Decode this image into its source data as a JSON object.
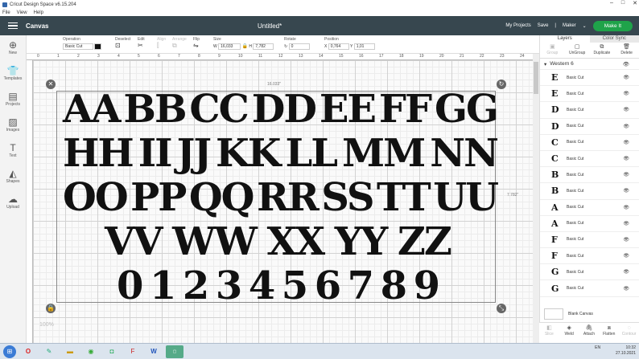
{
  "window": {
    "title": "Cricut Design Space  v6.15.204"
  },
  "menu": [
    "File",
    "View",
    "Help"
  ],
  "header": {
    "section": "Canvas",
    "doc_title": "Untitled*",
    "my_projects": "My Projects",
    "save": "Save",
    "machine": "Maker",
    "make_it": "Make It"
  },
  "sidebar": [
    {
      "label": "New",
      "icon": "plus-icon"
    },
    {
      "label": "Templates",
      "icon": "shirt-icon"
    },
    {
      "label": "Projects",
      "icon": "folder-icon"
    },
    {
      "label": "Images",
      "icon": "image-icon"
    },
    {
      "label": "Text",
      "icon": "text-icon"
    },
    {
      "label": "Shapes",
      "icon": "shapes-icon"
    },
    {
      "label": "Upload",
      "icon": "cloud-upload-icon"
    }
  ],
  "toolbar": {
    "operation_label": "Operation",
    "operation_value": "Basic Cut",
    "deselect": "Deselect",
    "edit": "Edit",
    "align": "Align",
    "arrange": "Arrange",
    "flip": "Flip",
    "size_label": "Size",
    "w_label": "W",
    "w_value": "16,033",
    "h_label": "H",
    "h_value": "7,782",
    "rotate_label": "Rotate",
    "rotate_value": "0",
    "position_label": "Position",
    "x_label": "X",
    "x_value": "0,764",
    "y_label": "Y",
    "y_value": "1,01",
    "swatch_color": "#111111"
  },
  "ruler_top": [
    "0",
    "1",
    "2",
    "3",
    "4",
    "5",
    "6",
    "7",
    "8",
    "9",
    "10",
    "11",
    "12",
    "13",
    "14",
    "15",
    "16",
    "17",
    "18",
    "19",
    "20",
    "21",
    "22",
    "23",
    "24"
  ],
  "canvas": {
    "width_label": "16.033\"",
    "height_label": "7.782\"",
    "zoom": "100%",
    "rows": [
      [
        "AA",
        "BB",
        "CC",
        "DD",
        "EE",
        "FF",
        "GG"
      ],
      [
        "HH",
        "II",
        "JJ",
        "KK",
        "LL",
        "MM",
        "NN"
      ],
      [
        "OO",
        "PP",
        "QQ",
        "RR",
        "SS",
        "TT",
        "UU"
      ],
      [
        "VV",
        "WW",
        "XX",
        "YY",
        "ZZ"
      ],
      [
        "0",
        "1",
        "2",
        "3",
        "4",
        "5",
        "6",
        "7",
        "8",
        "9"
      ]
    ]
  },
  "panel": {
    "tabs": [
      "Layers",
      "Color Sync"
    ],
    "actions": [
      "Group",
      "UnGroup",
      "Duplicate",
      "Delete"
    ],
    "group_name": "Western 6",
    "layers": [
      {
        "glyph": "E",
        "name": "Basic Cut"
      },
      {
        "glyph": "E",
        "name": "Basic Cut"
      },
      {
        "glyph": "D",
        "name": "Basic Cut"
      },
      {
        "glyph": "D",
        "name": "Basic Cut"
      },
      {
        "glyph": "C",
        "name": "Basic Cut"
      },
      {
        "glyph": "C",
        "name": "Basic Cut"
      },
      {
        "glyph": "B",
        "name": "Basic Cut"
      },
      {
        "glyph": "B",
        "name": "Basic Cut"
      },
      {
        "glyph": "A",
        "name": "Basic Cut"
      },
      {
        "glyph": "A",
        "name": "Basic Cut"
      },
      {
        "glyph": "F",
        "name": "Basic Cut"
      },
      {
        "glyph": "F",
        "name": "Basic Cut"
      },
      {
        "glyph": "G",
        "name": "Basic Cut"
      },
      {
        "glyph": "G",
        "name": "Basic Cut"
      }
    ],
    "blank_canvas": "Blank Canvas",
    "bottom_actions": [
      "Slice",
      "Weld",
      "Attach",
      "Flatten",
      "Contour"
    ]
  },
  "taskbar": {
    "lang": "EN",
    "time": "10:32",
    "date": "27.10.2021"
  }
}
